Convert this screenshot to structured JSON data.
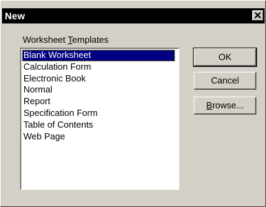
{
  "window": {
    "title": "New",
    "close_glyph": "×"
  },
  "templates": {
    "label_prefix": "Worksheet ",
    "label_mnemonic": "T",
    "label_suffix": "emplates",
    "items": [
      "Blank Worksheet",
      "Calculation Form",
      "Electronic Book",
      "Normal",
      "Report",
      "Specification Form",
      "Table of Contents",
      "Web Page"
    ],
    "selected_index": 0
  },
  "buttons": {
    "ok_label": "OK",
    "cancel_label": "Cancel",
    "browse_mnemonic": "B",
    "browse_rest": "rowse..."
  },
  "colors": {
    "selection_bg": "#000080",
    "dialog_bg": "#d4d0c8",
    "titlebar_bg": "#000000"
  },
  "icons": {
    "close": "close-icon"
  }
}
